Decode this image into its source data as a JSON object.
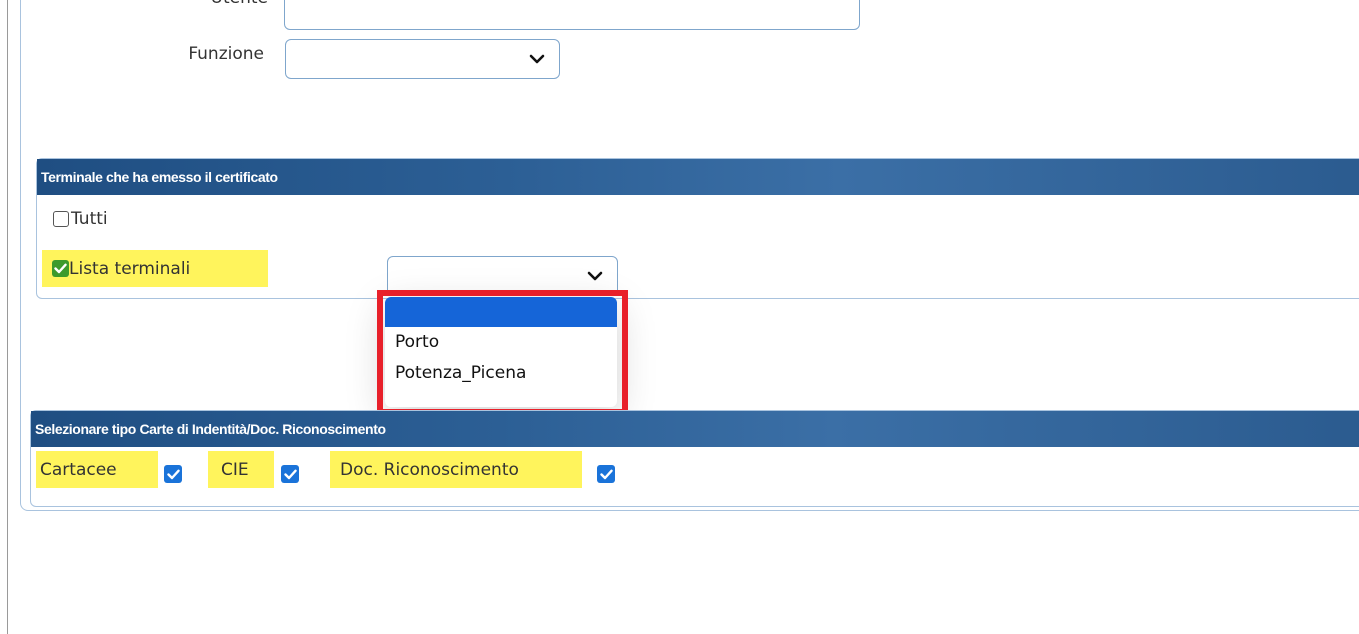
{
  "form": {
    "utente_label": "Utente",
    "funzione_label": "Funzione",
    "funzione_value": ""
  },
  "terminal_section": {
    "title": "Terminale che ha emesso il certificato",
    "tutti_label": "Tutti",
    "tutti_checked": false,
    "lista_label": "Lista terminali",
    "lista_checked": true,
    "terminal_select_value": "",
    "options": [
      "",
      "Porto",
      "Potenza_Picena"
    ]
  },
  "id_section": {
    "title": "Selezionare tipo Carte di Indentità/Doc. Riconoscimento",
    "cartacee_label": "Cartacee",
    "cie_label": "CIE",
    "doc_label": "Doc. Riconoscimento",
    "cartacee_checked": true,
    "cie_checked": true,
    "doc_checked": true
  },
  "colors": {
    "header_blue": "#2c5f95",
    "highlight_yellow": "#fff45c",
    "annotation_red": "#e8202a",
    "selected_option_blue": "#1565d8",
    "checkbox_green": "#3c9a2c",
    "checkbox_blue": "#1a73d9"
  }
}
